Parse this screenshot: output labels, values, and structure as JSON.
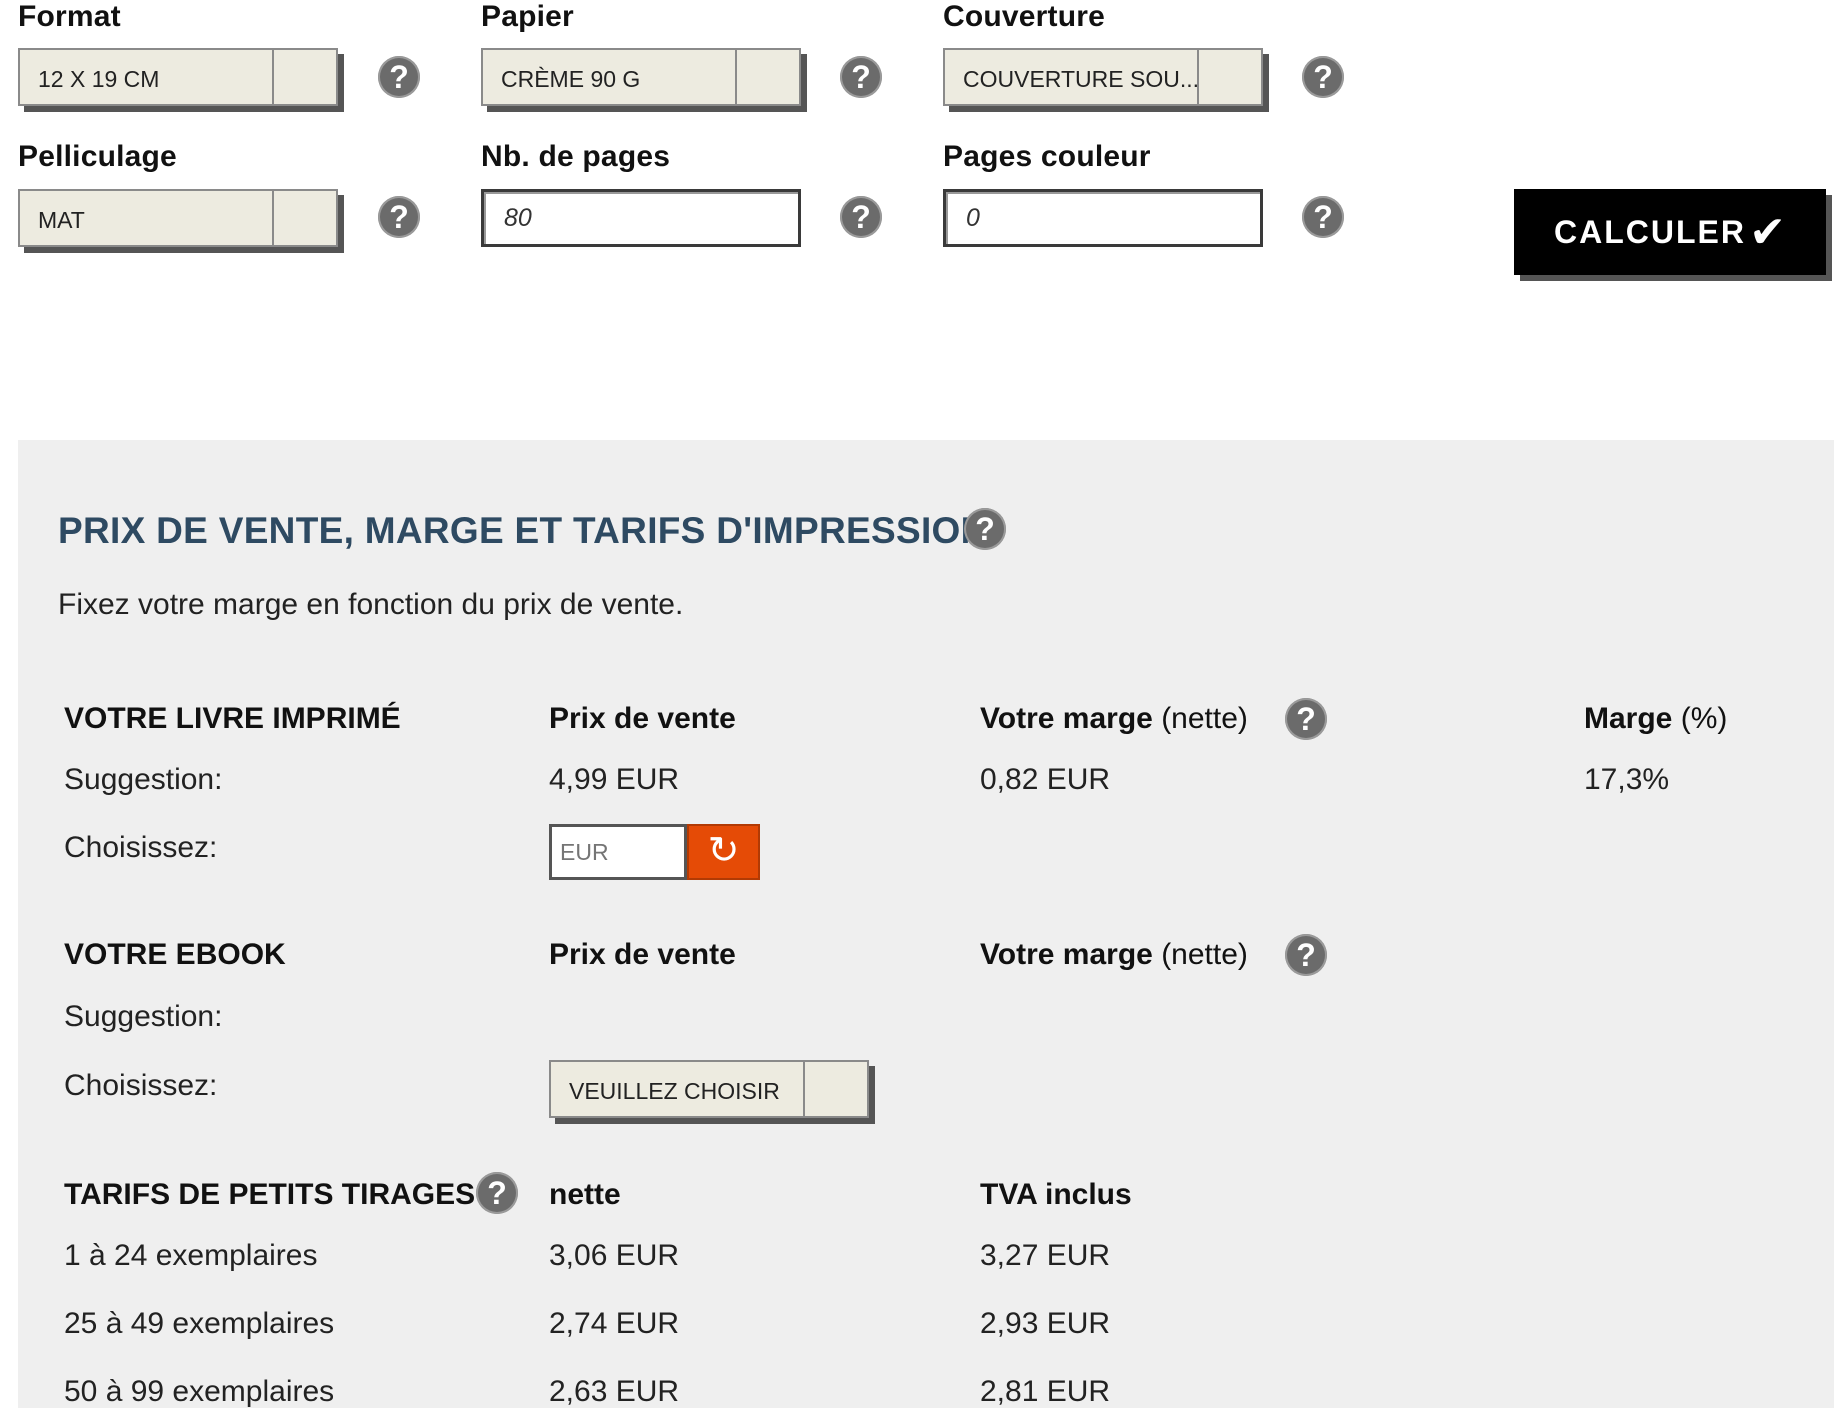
{
  "form": {
    "format": {
      "label": "Format",
      "value": "12 X 19 CM"
    },
    "papier": {
      "label": "Papier",
      "value": "CRÈME 90 G"
    },
    "couverture": {
      "label": "Couverture",
      "value": "COUVERTURE SOU..."
    },
    "pelliculage": {
      "label": "Pelliculage",
      "value": "MAT"
    },
    "nb_pages": {
      "label": "Nb. de pages",
      "value": "80"
    },
    "pages_couleur": {
      "label": "Pages couleur",
      "value": "0"
    },
    "help_icon": "?",
    "calc_button": "CALCULER",
    "calc_icon": "check-icon"
  },
  "panel": {
    "title": "PRIX DE VENTE, MARGE ET TARIFS D'IMPRESSION",
    "description": "Fixez votre marge en fonction du prix de vente.",
    "printed": {
      "heading": "VOTRE LIVRE IMPRIMÉ",
      "col_price": "Prix de vente",
      "col_margin": "Votre marge",
      "col_margin_sub": "(nette)",
      "col_pct": "Marge",
      "col_pct_sub": "(%)",
      "suggestion_label": "Suggestion:",
      "suggestion_price": "4,99 EUR",
      "suggestion_margin": "0,82 EUR",
      "suggestion_pct": "17,3%",
      "choose_label": "Choisissez:",
      "eur_placeholder": "EUR"
    },
    "ebook": {
      "heading": "VOTRE EBOOK",
      "col_price": "Prix de vente",
      "col_margin": "Votre marge",
      "col_margin_sub": "(nette)",
      "suggestion_label": "Suggestion:",
      "choose_label": "Choisissez:",
      "choose_value": "VEUILLEZ CHOISIR"
    },
    "tirages": {
      "heading": "TARIFS DE PETITS TIRAGES",
      "col_net": "nette",
      "col_tva": "TVA inclus",
      "rows": [
        {
          "label": "1 à 24 exemplaires",
          "net": "3,06 EUR",
          "tva": "3,27 EUR"
        },
        {
          "label": "25 à 49 exemplaires",
          "net": "2,74 EUR",
          "tva": "2,93 EUR"
        },
        {
          "label": "50 à 99 exemplaires",
          "net": "2,63 EUR",
          "tva": "2,81 EUR"
        }
      ]
    }
  },
  "colors": {
    "accent_orange": "#e54b06",
    "title_blue": "#2e4a62",
    "panel_bg": "#efefef"
  }
}
